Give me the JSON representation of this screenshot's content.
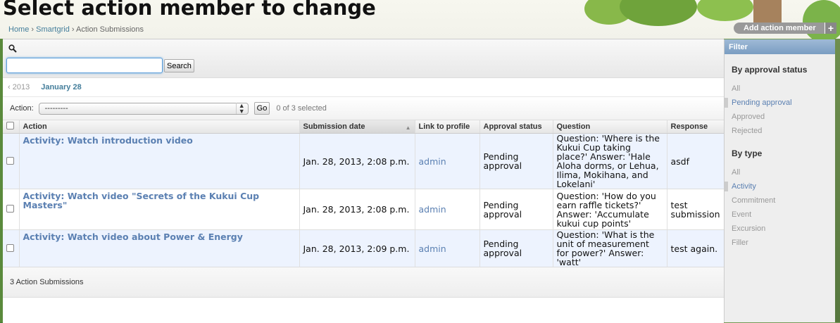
{
  "page": {
    "title": "Select action member to change",
    "breadcrumb": {
      "home": "Home",
      "app": "Smartgrid",
      "current": "Action Submissions",
      "sep": "›"
    }
  },
  "add_button": {
    "label": "Add action member",
    "plus": "+"
  },
  "search": {
    "value": "",
    "placeholder": "",
    "button_label": "Search"
  },
  "date_hierarchy": {
    "back": "‹ 2013",
    "current": "January 28"
  },
  "actions": {
    "label": "Action:",
    "selected_option": "---------",
    "go_label": "Go",
    "counter": "0 of 3 selected"
  },
  "table": {
    "headers": [
      "Action",
      "Submission date",
      "Link to profile",
      "Approval status",
      "Question",
      "Response"
    ],
    "sorted_column": "Submission date",
    "rows": [
      {
        "action": "Activity: Watch introduction video",
        "date": "Jan. 28, 2013, 2:08 p.m.",
        "profile": "admin",
        "status": "Pending approval",
        "question": "Question: 'Where is the Kukui Cup taking place?' Answer: 'Hale Aloha dorms, or Lehua, Ilima, Mokihana, and Lokelani'",
        "response": "asdf"
      },
      {
        "action": "Activity: Watch video \"Secrets of the Kukui Cup Masters\"",
        "date": "Jan. 28, 2013, 2:08 p.m.",
        "profile": "admin",
        "status": "Pending approval",
        "question": "Question: 'How do you earn raffle tickets?' Answer: 'Accumulate kukui cup points'",
        "response": "test submission"
      },
      {
        "action": "Activity: Watch video about Power & Energy",
        "date": "Jan. 28, 2013, 2:09 p.m.",
        "profile": "admin",
        "status": "Pending approval",
        "question": "Question: 'What is the unit of measurement for power?' Answer: 'watt'",
        "response": "test again."
      }
    ],
    "footer_count": "3 Action Submissions"
  },
  "filter": {
    "title": "Filter",
    "groups": [
      {
        "heading": "By approval status",
        "items": [
          "All",
          "Pending approval",
          "Approved",
          "Rejected"
        ],
        "selected": "Pending approval"
      },
      {
        "heading": "By type",
        "items": [
          "All",
          "Activity",
          "Commitment",
          "Event",
          "Excursion",
          "Filler"
        ],
        "selected": "Activity"
      }
    ]
  },
  "colors": {
    "link": "#5b80b2",
    "filter_header": "#7a9dc2",
    "row_alt": "#edf3fe"
  },
  "icons": {
    "search": "search-icon",
    "sort": "sort-asc-icon",
    "plus": "plus-icon"
  }
}
